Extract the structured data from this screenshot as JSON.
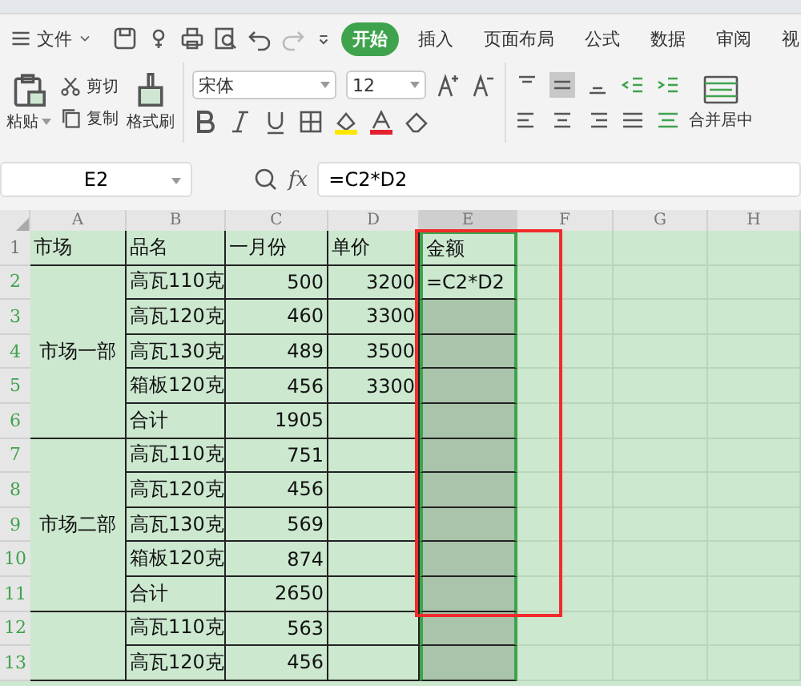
{
  "menu": {
    "file": "文件",
    "tabs": [
      {
        "label": "开始",
        "selected": true
      },
      {
        "label": "插入",
        "selected": false
      },
      {
        "label": "页面布局",
        "selected": false
      },
      {
        "label": "公式",
        "selected": false
      },
      {
        "label": "数据",
        "selected": false
      },
      {
        "label": "审阅",
        "selected": false
      },
      {
        "label": "视",
        "selected": false
      }
    ]
  },
  "ribbon": {
    "paste": "粘贴",
    "cut": "剪切",
    "copy": "复制",
    "format_painter": "格式刷",
    "font": "宋体",
    "size": "12",
    "merge": "合并居中"
  },
  "formula_bar": {
    "name_box": "E2",
    "fx": "fx",
    "formula": "=C2*D2"
  },
  "sheet": {
    "columns": [
      {
        "label": "A",
        "selected": false
      },
      {
        "label": "B",
        "selected": false
      },
      {
        "label": "C",
        "selected": false
      },
      {
        "label": "D",
        "selected": false
      },
      {
        "label": "E",
        "selected": true
      },
      {
        "label": "F",
        "selected": false
      },
      {
        "label": "G",
        "selected": false
      },
      {
        "label": "H",
        "selected": false
      }
    ],
    "header": {
      "number": "1",
      "selected": false,
      "cells": [
        "市场",
        "品名",
        "一月份",
        "单价",
        "金额"
      ]
    },
    "groups": [
      {
        "market": "市场一部",
        "rows": [
          {
            "number": "2",
            "selected": true,
            "name": "高瓦110克",
            "qty": "500",
            "price": "3200",
            "amount": {
              "text": "=C2*D2",
              "selected": false
            }
          },
          {
            "number": "3",
            "selected": true,
            "name": "高瓦120克",
            "qty": "460",
            "price": "3300",
            "amount": {
              "selected": true
            }
          },
          {
            "number": "4",
            "selected": true,
            "name": "高瓦130克",
            "qty": "489",
            "price": "3500",
            "amount": {
              "selected": true
            }
          },
          {
            "number": "5",
            "selected": true,
            "name": "箱板120克",
            "qty": "456",
            "price": "3300",
            "amount": {
              "selected": true
            }
          },
          {
            "number": "6",
            "selected": true,
            "name": "合计",
            "qty": "1905",
            "amount": {
              "selected": true
            }
          }
        ]
      },
      {
        "market": "市场二部",
        "rows": [
          {
            "number": "7",
            "selected": true,
            "name": "高瓦110克",
            "qty": "751",
            "amount": {
              "selected": true
            }
          },
          {
            "number": "8",
            "selected": true,
            "name": "高瓦120克",
            "qty": "456",
            "amount": {
              "selected": true
            }
          },
          {
            "number": "9",
            "selected": true,
            "name": "高瓦130克",
            "qty": "569",
            "amount": {
              "selected": true
            }
          },
          {
            "number": "10",
            "selected": true,
            "name": "箱板120克",
            "qty": "874",
            "amount": {
              "selected": true
            }
          },
          {
            "number": "11",
            "selected": true,
            "name": "合计",
            "qty": "2650",
            "amount": {
              "selected": true
            }
          }
        ]
      },
      {
        "rows": [
          {
            "number": "12",
            "selected": true,
            "name": "高瓦110克",
            "qty": "563",
            "amount": {
              "selected": true
            }
          },
          {
            "number": "13",
            "selected": true,
            "name": "高瓦120克",
            "qty": "456",
            "amount": {
              "selected": true
            }
          }
        ]
      }
    ]
  }
}
